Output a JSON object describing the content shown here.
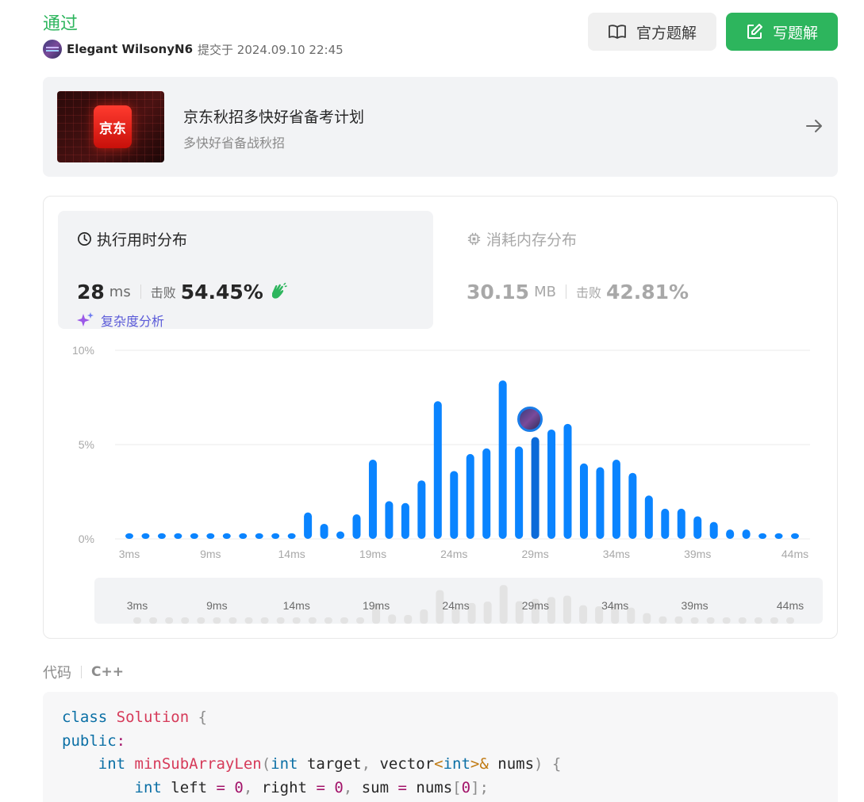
{
  "header": {
    "status": "通过",
    "submitter_name": "Elegant WilsonyN6",
    "submitted_meta": "提交于 2024.09.10 22:45",
    "official_solution_label": "官方题解",
    "write_solution_label": "写题解"
  },
  "banner": {
    "logo_text": "京东",
    "title": "京东秋招多快好省备考计划",
    "subtitle": "多快好省备战秋招"
  },
  "runtime": {
    "title": "执行用时分布",
    "value": "28",
    "unit": "ms",
    "beat_label": "击败",
    "beat_pct": "54.45%",
    "complexity_label": "复杂度分析"
  },
  "memory": {
    "title": "消耗内存分布",
    "value": "30.15",
    "unit": "MB",
    "beat_label": "击败",
    "beat_pct": "42.81%"
  },
  "chart_data": {
    "type": "bar",
    "x": [
      3,
      4,
      5,
      6,
      7,
      8,
      9,
      10,
      11,
      12,
      13,
      14,
      15,
      16,
      17,
      18,
      19,
      20,
      21,
      22,
      23,
      24,
      25,
      26,
      27,
      28,
      29,
      30,
      31,
      32,
      33,
      34,
      35,
      36,
      37,
      38,
      39,
      40,
      41,
      42,
      43,
      44
    ],
    "values": [
      0.3,
      0.3,
      0.3,
      0.3,
      0.3,
      0.3,
      0.3,
      0.3,
      0.3,
      0.3,
      0.3,
      1.4,
      0.8,
      0.4,
      1.3,
      4.2,
      2.0,
      1.9,
      3.1,
      7.3,
      3.6,
      4.5,
      4.8,
      8.4,
      4.9,
      5.4,
      5.8,
      6.1,
      4.0,
      3.8,
      4.2,
      3.5,
      2.3,
      1.6,
      1.6,
      1.2,
      0.9,
      0.5,
      0.5,
      0.3,
      0.3,
      0.3
    ],
    "highlight_x": 28,
    "y_ticks": [
      "10%",
      "5%",
      "0%"
    ],
    "x_tick_labels": [
      "3ms",
      "9ms",
      "14ms",
      "19ms",
      "24ms",
      "29ms",
      "34ms",
      "39ms",
      "44ms"
    ],
    "mini_tick_labels": [
      "3ms",
      "9ms",
      "14ms",
      "19ms",
      "24ms",
      "29ms",
      "34ms",
      "39ms",
      "44ms"
    ],
    "ylim": [
      0,
      10
    ],
    "bar_color": "#0a84ff",
    "highlight_color": "#0b6ad8"
  },
  "code": {
    "label": "代码",
    "language": "C++"
  },
  "colors": {
    "accent_green": "#2db55d",
    "bar_blue": "#0a84ff"
  }
}
